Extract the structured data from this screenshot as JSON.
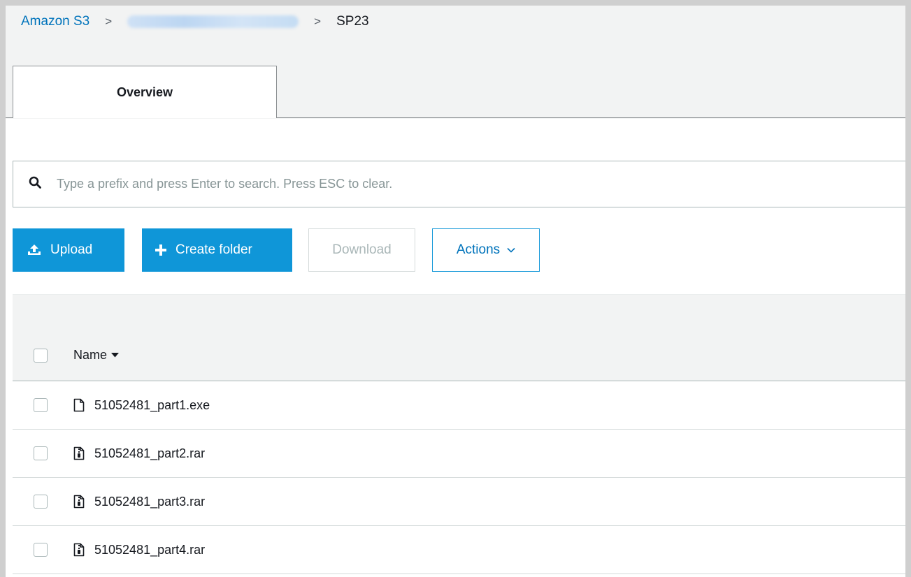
{
  "breadcrumb": {
    "root": "Amazon S3",
    "current": "SP23"
  },
  "tabs": [
    {
      "label": "Overview"
    }
  ],
  "search": {
    "placeholder": "Type a prefix and press Enter to search. Press ESC to clear."
  },
  "toolbar": {
    "upload": "Upload",
    "create_folder": "Create folder",
    "download": "Download",
    "actions": "Actions"
  },
  "table": {
    "name_header": "Name",
    "rows": [
      {
        "name": "51052481_part1.exe",
        "icon": "file-icon"
      },
      {
        "name": "51052481_part2.rar",
        "icon": "archive-file-icon"
      },
      {
        "name": "51052481_part3.rar",
        "icon": "archive-file-icon"
      },
      {
        "name": "51052481_part4.rar",
        "icon": "archive-file-icon"
      }
    ]
  },
  "colors": {
    "primary": "#0f96d8",
    "link": "#0073bb",
    "band": "#f2f3f3"
  }
}
